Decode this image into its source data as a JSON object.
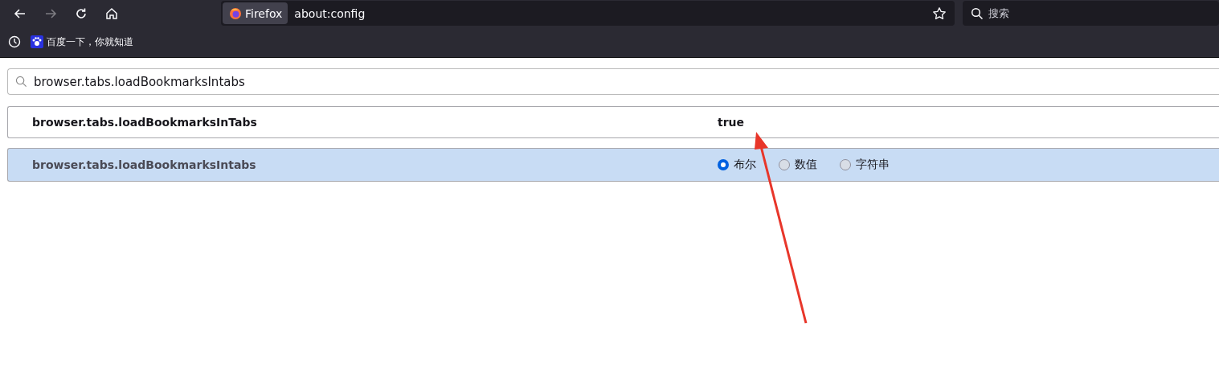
{
  "toolbar": {
    "back_disabled": false,
    "forward_disabled": true,
    "identity_label": "Firefox",
    "url": "about:config",
    "search_placeholder": "搜索"
  },
  "bookmarks": [
    {
      "label": "百度一下，你就知道"
    }
  ],
  "filter": {
    "value": "browser.tabs.loadBookmarksIntabs"
  },
  "prefs": [
    {
      "kind": "existing",
      "name": "browser.tabs.loadBookmarksInTabs",
      "value": "true"
    },
    {
      "kind": "new",
      "name": "browser.tabs.loadBookmarksIntabs",
      "types": [
        {
          "label": "布尔",
          "selected": true
        },
        {
          "label": "数值",
          "selected": false
        },
        {
          "label": "字符串",
          "selected": false
        }
      ]
    }
  ]
}
